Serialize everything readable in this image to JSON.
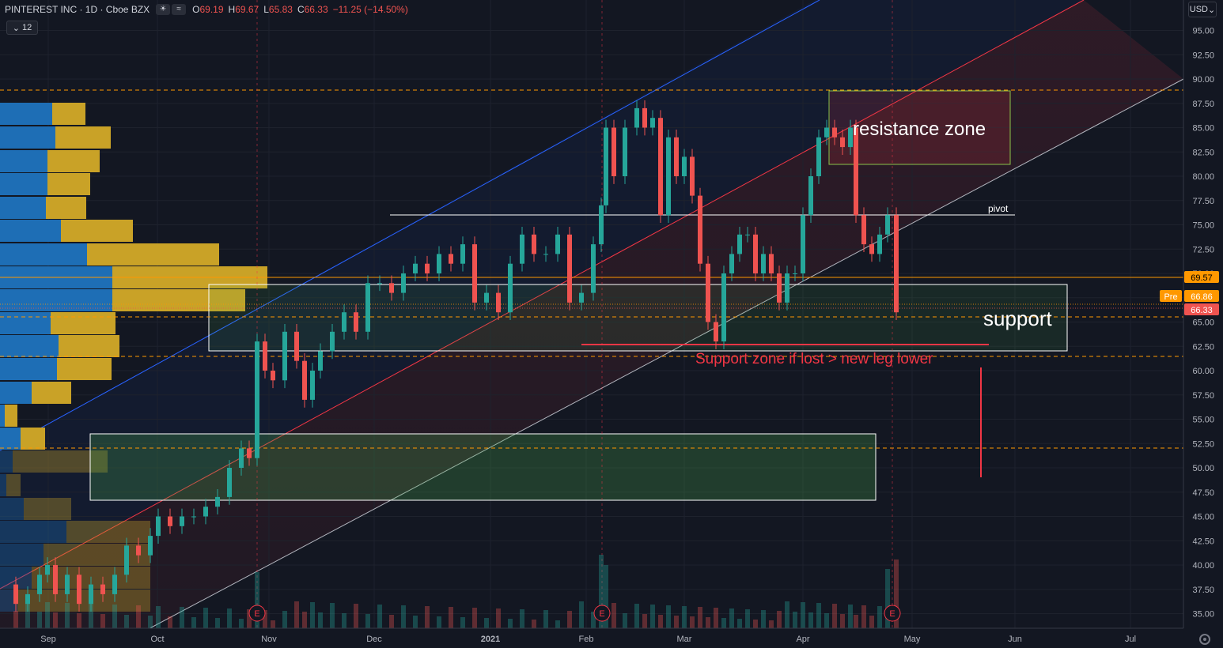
{
  "header": {
    "symbol": "PINTEREST INC · 1D · Cboe BZX",
    "open_label": "O",
    "open": "69.19",
    "high_label": "H",
    "high": "69.67",
    "low_label": "L",
    "low": "65.83",
    "close_label": "C",
    "close": "66.33",
    "change": "−11.25 (−14.50%)"
  },
  "indicator_tag": "12",
  "currency": "USD",
  "price_axis": {
    "ticks": [
      "95.00",
      "92.50",
      "90.00",
      "87.50",
      "85.00",
      "82.50",
      "80.00",
      "77.50",
      "75.00",
      "72.50",
      "70.00",
      "67.50",
      "65.00",
      "62.50",
      "60.00",
      "57.50",
      "55.00",
      "52.50",
      "50.00",
      "47.50",
      "45.00",
      "42.50",
      "40.00",
      "37.50",
      "35.00"
    ],
    "last_price_tag": "66.33",
    "level_tag": "69.57",
    "pre_label": "Pre",
    "pre_price": "66.86"
  },
  "time_axis": [
    "Sep",
    "Oct",
    "Nov",
    "Dec",
    "2021",
    "Feb",
    "Mar",
    "Apr",
    "May",
    "Jun",
    "Jul"
  ],
  "annotations": {
    "resistance": "resistance zone",
    "pivot": "pivot",
    "support": "support",
    "support_note": "Support zone if lost > new leg lower",
    "earnings": "E"
  },
  "colors": {
    "background": "#131722",
    "up": "#26a69a",
    "down": "#ef5350",
    "volume_profile_blue": "#1e6eb5",
    "volume_profile_gold": "#c9a227",
    "level_orange": "#ff9800",
    "channel_blue": "#2962ff",
    "channel_red": "#f23645",
    "channel_grey": "#b2b5be"
  }
}
